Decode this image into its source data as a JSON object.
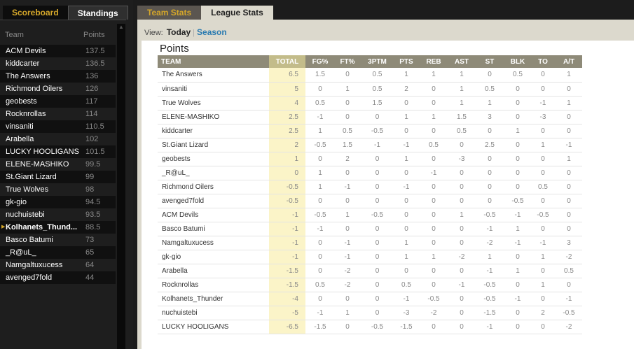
{
  "left_tabs": [
    "Scoreboard",
    "Standings"
  ],
  "standings": {
    "headers": [
      "Team",
      "Points"
    ],
    "selected": "Kolhanets_Thund...",
    "rows": [
      [
        "ACM Devils",
        "137.5"
      ],
      [
        "kiddcarter",
        "136.5"
      ],
      [
        "The Answers",
        "136"
      ],
      [
        "Richmond Oilers",
        "126"
      ],
      [
        "geobests",
        "117"
      ],
      [
        "Rocknrollas",
        "114"
      ],
      [
        "vinsaniti",
        "110.5"
      ],
      [
        "Arabella",
        "102"
      ],
      [
        "LUCKY HOOLIGANS",
        "101.5"
      ],
      [
        "ELENE-MASHIKO",
        "99.5"
      ],
      [
        "St.Giant Lizard",
        "99"
      ],
      [
        "True Wolves",
        "98"
      ],
      [
        "gk-gio",
        "94.5"
      ],
      [
        "nuchuistebi",
        "93.5"
      ],
      [
        "Kolhanets_Thund...",
        "88.5"
      ],
      [
        "Basco Batumi",
        "73"
      ],
      [
        "_R@uL_",
        "65"
      ],
      [
        "Namgaltuxucess",
        "64"
      ],
      [
        "avenged7fold",
        "44"
      ]
    ]
  },
  "right_tabs": [
    "Team Stats",
    "League Stats"
  ],
  "view": {
    "label": "View:",
    "today": "Today",
    "season": "Season"
  },
  "section_title": "Points",
  "table": {
    "headers": [
      "TEAM",
      "TOTAL",
      "FG%",
      "FT%",
      "3PTM",
      "PTS",
      "REB",
      "AST",
      "ST",
      "BLK",
      "TO",
      "A/T"
    ],
    "rows": [
      [
        "The Answers",
        "6.5",
        "1.5",
        "0",
        "0.5",
        "1",
        "1",
        "1",
        "0",
        "0.5",
        "0",
        "1"
      ],
      [
        "vinsaniti",
        "5",
        "0",
        "1",
        "0.5",
        "2",
        "0",
        "1",
        "0.5",
        "0",
        "0",
        "0"
      ],
      [
        "True Wolves",
        "4",
        "0.5",
        "0",
        "1.5",
        "0",
        "0",
        "1",
        "1",
        "0",
        "-1",
        "1"
      ],
      [
        "ELENE-MASHIKO",
        "2.5",
        "-1",
        "0",
        "0",
        "1",
        "1",
        "1.5",
        "3",
        "0",
        "-3",
        "0"
      ],
      [
        "kiddcarter",
        "2.5",
        "1",
        "0.5",
        "-0.5",
        "0",
        "0",
        "0.5",
        "0",
        "1",
        "0",
        "0"
      ],
      [
        "St.Giant Lizard",
        "2",
        "-0.5",
        "1.5",
        "-1",
        "-1",
        "0.5",
        "0",
        "2.5",
        "0",
        "1",
        "-1"
      ],
      [
        "geobests",
        "1",
        "0",
        "2",
        "0",
        "1",
        "0",
        "-3",
        "0",
        "0",
        "0",
        "1"
      ],
      [
        "_R@uL_",
        "0",
        "1",
        "0",
        "0",
        "0",
        "-1",
        "0",
        "0",
        "0",
        "0",
        "0"
      ],
      [
        "Richmond Oilers",
        "-0.5",
        "1",
        "-1",
        "0",
        "-1",
        "0",
        "0",
        "0",
        "0",
        "0.5",
        "0"
      ],
      [
        "avenged7fold",
        "-0.5",
        "0",
        "0",
        "0",
        "0",
        "0",
        "0",
        "0",
        "-0.5",
        "0",
        "0"
      ],
      [
        "ACM Devils",
        "-1",
        "-0.5",
        "1",
        "-0.5",
        "0",
        "0",
        "1",
        "-0.5",
        "-1",
        "-0.5",
        "0"
      ],
      [
        "Basco Batumi",
        "-1",
        "-1",
        "0",
        "0",
        "0",
        "0",
        "0",
        "-1",
        "1",
        "0",
        "0"
      ],
      [
        "Namgaltuxucess",
        "-1",
        "0",
        "-1",
        "0",
        "1",
        "0",
        "0",
        "-2",
        "-1",
        "-1",
        "3"
      ],
      [
        "gk-gio",
        "-1",
        "0",
        "-1",
        "0",
        "1",
        "1",
        "-2",
        "1",
        "0",
        "1",
        "-2"
      ],
      [
        "Arabella",
        "-1.5",
        "0",
        "-2",
        "0",
        "0",
        "0",
        "0",
        "-1",
        "1",
        "0",
        "0.5"
      ],
      [
        "Rocknrollas",
        "-1.5",
        "0.5",
        "-2",
        "0",
        "0.5",
        "0",
        "-1",
        "-0.5",
        "0",
        "1",
        "0"
      ],
      [
        "Kolhanets_Thunder",
        "-4",
        "0",
        "0",
        "0",
        "-1",
        "-0.5",
        "0",
        "-0.5",
        "-1",
        "0",
        "-1"
      ],
      [
        "nuchuistebi",
        "-5",
        "-1",
        "1",
        "0",
        "-3",
        "-2",
        "0",
        "-1.5",
        "0",
        "2",
        "-0.5"
      ],
      [
        "LUCKY HOOLIGANS",
        "-6.5",
        "-1.5",
        "0",
        "-0.5",
        "-1.5",
        "0",
        "0",
        "-1",
        "0",
        "0",
        "-2"
      ]
    ]
  }
}
